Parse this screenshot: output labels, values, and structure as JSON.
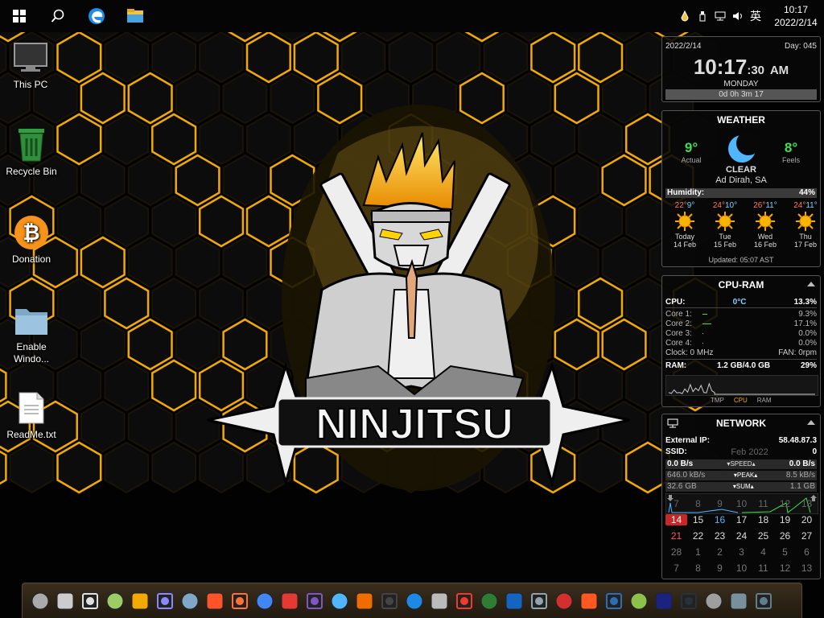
{
  "taskbar": {
    "start": "windows-start-icon",
    "search": "search-icon",
    "edge": "edge-icon",
    "explorer": "file-explorer-icon"
  },
  "tray": {
    "ime": "英",
    "time": "10:17",
    "date": "2022/2/14"
  },
  "desktop_icons": [
    {
      "label": "This PC",
      "icon": "monitor-icon"
    },
    {
      "label": "Recycle Bin",
      "icon": "recycle-bin-icon"
    },
    {
      "label": "Donation",
      "icon": "bitcoin-icon"
    },
    {
      "label": "Enable Windo...",
      "icon": "folder-icon"
    },
    {
      "label": "ReadMe.txt",
      "icon": "text-file-icon"
    }
  ],
  "wallpaper": {
    "logo_text": "NINJITSU",
    "accent": "#f2a900"
  },
  "clock_gadget": {
    "date": "2022/2/14",
    "day_number": "Day: 045",
    "time": "10:17",
    "seconds": ":30",
    "ampm": "AM",
    "weekday": "MONDAY",
    "uptime": "0d 0h 3m 17"
  },
  "weather": {
    "title": "WEATHER",
    "actual_temp": "9°",
    "actual_label": "Actual",
    "condition": "CLEAR",
    "feels_temp": "8°",
    "feels_label": "Feels",
    "location": "Ad Dirah, SA",
    "humidity_label": "Humidity:",
    "humidity": "44%",
    "forecast": [
      {
        "hi": "22°",
        "lo": "9°",
        "day": "Today",
        "date": "14 Feb"
      },
      {
        "hi": "24°",
        "lo": "10°",
        "day": "Tue",
        "date": "15 Feb"
      },
      {
        "hi": "26°",
        "lo": "11°",
        "day": "Wed",
        "date": "16 Feb"
      },
      {
        "hi": "24°",
        "lo": "11°",
        "day": "Thu",
        "date": "17 Feb"
      }
    ],
    "updated": "Updated: 05:07 AST"
  },
  "cpuram": {
    "title": "CPU-RAM",
    "cpu_label": "CPU:",
    "cpu_temp": "0°C",
    "cpu_pct": "13.3%",
    "cores": [
      {
        "label": "Core 1:",
        "pct": "9.3%",
        "usage": 0.093
      },
      {
        "label": "Core 2:",
        "pct": "17.1%",
        "usage": 0.171
      },
      {
        "label": "Core 3:",
        "pct": "0.0%",
        "usage": 0
      },
      {
        "label": "Core 4:",
        "pct": "0.0%",
        "usage": 0
      }
    ],
    "clock": "Clock: 0 MHz",
    "fan": "FAN: 0rpm",
    "ram_label": "RAM:",
    "ram_used": "1.2 GB/4.0 GB",
    "ram_pct": "29%",
    "graph_tabs": [
      "TMP",
      "CPU",
      "RAM"
    ],
    "cpu_history": [
      0.1,
      0.05,
      0.25,
      0.08,
      0.1,
      0.04,
      0.3,
      0.12,
      0.55,
      0.15,
      0.35,
      0.2,
      0.5,
      0.1,
      0.08,
      0.6,
      0.2,
      0.1
    ]
  },
  "network": {
    "title": "NETWORK",
    "ext_label": "External IP:",
    "ext_ip": "58.48.87.3",
    "ssid_label": "SSID:",
    "ssid": "0",
    "ssid_overlay": "Feb 2022",
    "down_speed": "0.0 B/s",
    "speed_label": "SPEED",
    "up_speed": "0.0 B/s",
    "down_peak": "646.0 kB/s",
    "peak_label": "PEAK",
    "up_peak": "8.5 kB/s",
    "down_sum": "32.6 GB",
    "sum_label": "SUM",
    "up_sum": "1.1 GB"
  },
  "calendar": {
    "rows": [
      [
        "7",
        "8",
        "9",
        "10",
        "11",
        "12",
        "13"
      ],
      [
        "14",
        "15",
        "16",
        "17",
        "18",
        "19",
        "20"
      ],
      [
        "21",
        "22",
        "23",
        "24",
        "25",
        "26",
        "27"
      ],
      [
        "28",
        "1",
        "2",
        "3",
        "4",
        "5",
        "6"
      ],
      [
        "7",
        "8",
        "9",
        "10",
        "11",
        "12",
        "13"
      ]
    ],
    "today": "14"
  },
  "dock_icons": [
    "thispc-icon",
    "image-viewer-icon",
    "user-icon",
    "settings-gear-icon",
    "magnifier-icon",
    "app-grid-icon",
    "download-icon",
    "brave-icon",
    "firefox-icon",
    "chrome-icon",
    "wps-icon",
    "tor-icon",
    "lock-icon",
    "vpn-icon",
    "terminal-dark-icon",
    "photos-icon",
    "sg-icon",
    "anydesk-icon",
    "system-monitor-icon",
    "network-icon",
    "globe-icon",
    "wifi-icon",
    "media-icon",
    "qbittorrent-icon",
    "notepad-icon",
    "powershell-icon",
    "cmd-icon",
    "gear-icon",
    "calculator-icon",
    "control-panel-icon"
  ]
}
